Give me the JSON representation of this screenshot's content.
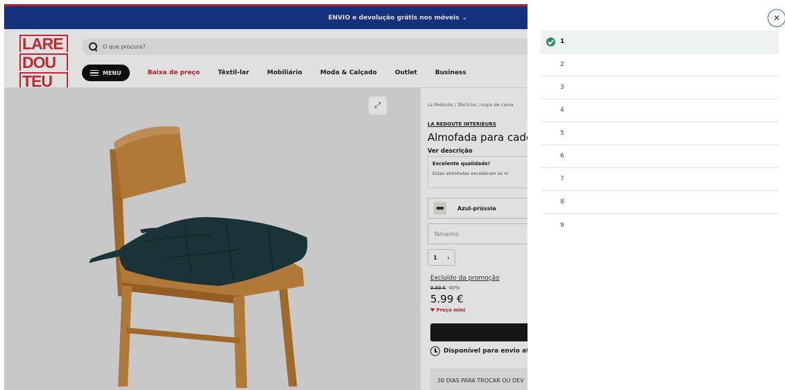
{
  "promo": {
    "text": "ENVIO e devolução grátis nos móveis",
    "chevron": "⌄"
  },
  "logo": {
    "lines": [
      "LARE",
      "DOU",
      "TEU"
    ]
  },
  "search": {
    "placeholder": "O que procura?"
  },
  "nav": {
    "menu_label": "MENU",
    "items": [
      "Baixa de preço",
      "Têxtil-lar",
      "Mobiliário",
      "Moda & Calçado",
      "Outlet",
      "Business"
    ]
  },
  "product": {
    "breadcrumb": "La Redoute / Têxtil-lar, roupa de cama",
    "brand": "LA REDOUTE INTERIEURS",
    "title": "Almofada para cade",
    "see_description": "Ver descrição",
    "review_title": "Excelente qualidade!",
    "review_body": "Estas almofadas excederam as m",
    "color": "Azul-prússia",
    "size_placeholder": "Tamanho",
    "qty": "1",
    "excluded": "Excluído da promoção",
    "old_price": "9.99 €",
    "discount": "-40%",
    "price": "5.99 €",
    "mini_label": "Preço mini",
    "availability": "Disponível para envio até",
    "returns": "30 DIAS PARA TROCAR OU DEV"
  },
  "dropdown": {
    "options": [
      "1",
      "2",
      "3",
      "4",
      "5",
      "6",
      "7",
      "8",
      "9"
    ],
    "selected": "1"
  },
  "colors": {
    "promo_bar": "#17398c",
    "accent_red": "#c8262b",
    "check_green": "#2a8c6a",
    "cushion": "#1d3b3f",
    "wood": "#c98a3f"
  }
}
